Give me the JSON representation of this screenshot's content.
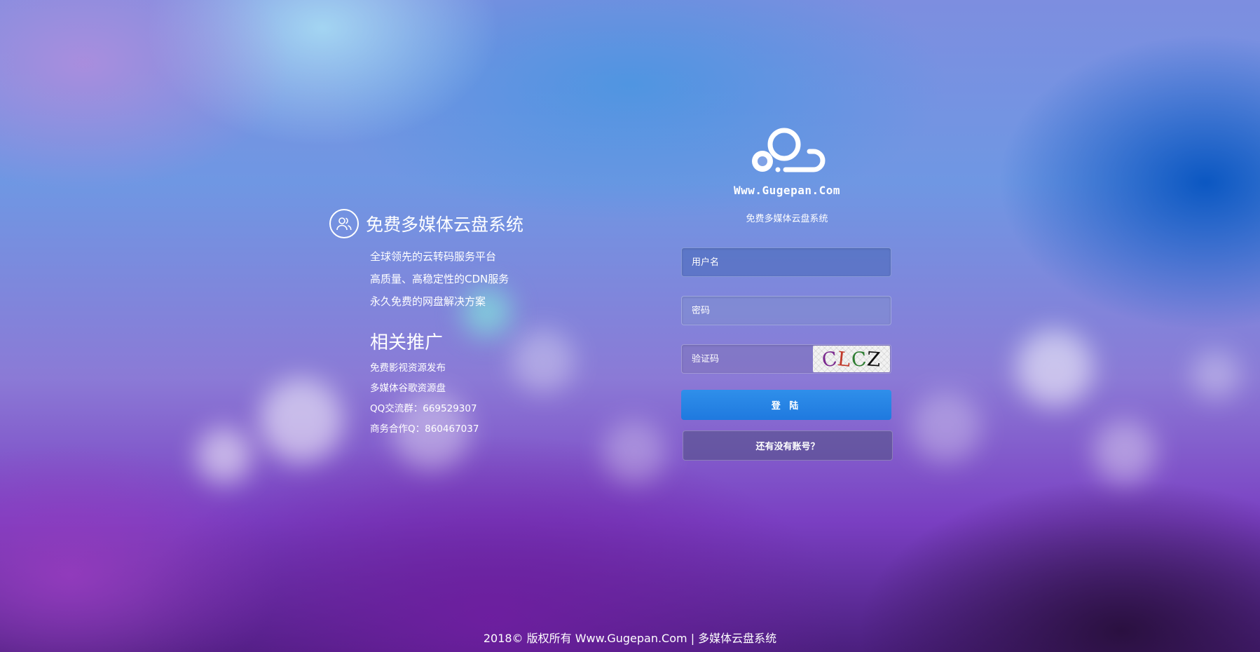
{
  "intro": {
    "brand": "免费多媒体云盘系统",
    "features": [
      "全球领先的云转码服务平台",
      "高质量、高稳定性的CDN服务",
      "永久免费的网盘解决方案"
    ],
    "recommend_title": "相关推广",
    "recommend_items": [
      "免费影视资源发布",
      "多媒体谷歌资源盘",
      "QQ交流群：669529307",
      "商务合作Q：860467037"
    ]
  },
  "login": {
    "logo_text": "Www.Gugepan.Com",
    "subtitle": "免费多媒体云盘系统",
    "username_placeholder": "用户名",
    "password_placeholder": "密码",
    "captcha_placeholder": "验证码",
    "captcha_chars": [
      "C",
      "L",
      "C",
      "Z"
    ],
    "captcha_colors": [
      "#7b2a8f",
      "#c0392b",
      "#2e7d32",
      "#111111"
    ],
    "login_label": "登 陆",
    "register_label": "还有没有账号？"
  },
  "footer": {
    "text": "2018© 版权所有 Www.Gugepan.Com | 多媒体云盘系统"
  },
  "colors": {
    "accent": "#2786e6"
  }
}
